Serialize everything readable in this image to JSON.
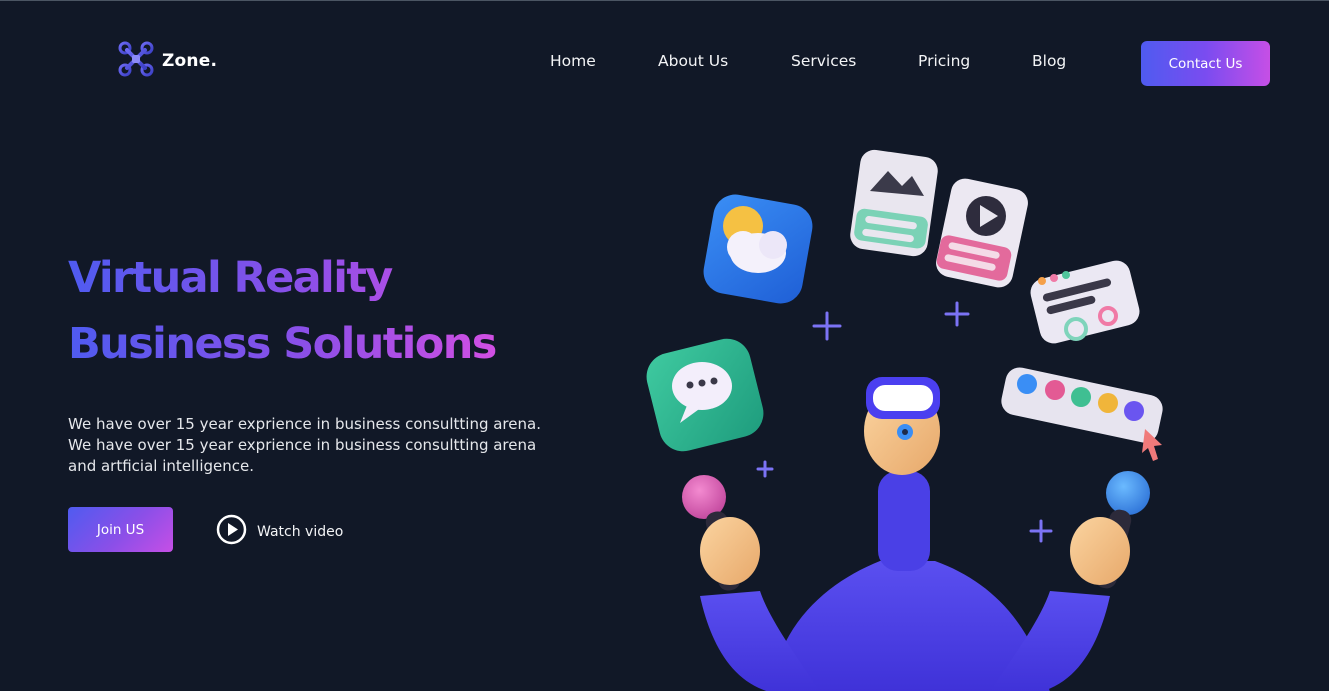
{
  "logo": {
    "icon": "drone-x-icon",
    "text": "Zone."
  },
  "nav": {
    "items": [
      {
        "label": "Home"
      },
      {
        "label": "About Us"
      },
      {
        "label": "Services"
      },
      {
        "label": "Pricing"
      },
      {
        "label": "Blog"
      }
    ],
    "contact_label": "Contact Us"
  },
  "hero": {
    "title_line1": "Virtual Reality",
    "title_line2": "Business Solutions",
    "description": "We have over 15 year exprience in business consultting arena. We have over 15 year exprience in business consultting arena and artficial intelligence.",
    "join_label": "Join US",
    "watch_label": "Watch video",
    "watch_icon": "play-circle-icon"
  },
  "colors": {
    "background": "#111827",
    "accent_start": "#4f5bf0",
    "accent_end": "#c64fe6"
  }
}
